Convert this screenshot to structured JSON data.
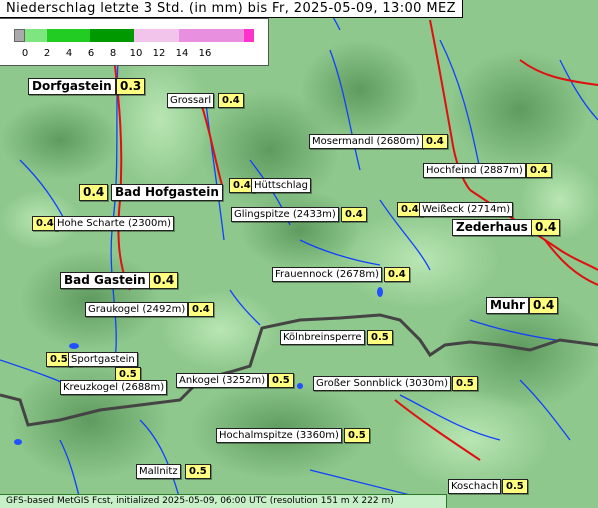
{
  "title": "Niederschlag letzte 3 Std. (in mm) bis Fr, 2025-05-09, 13:00 MEZ",
  "legend": {
    "ticks": [
      "0",
      "2",
      "4",
      "6",
      "8",
      "10",
      "12",
      "14",
      "16"
    ],
    "colors": {
      "zero": "#aaaaaa",
      "light": "#7ee67e",
      "mid": "#22cc22",
      "heavy": "#009900",
      "pinkLight": "#f2c4ec",
      "pinkMid": "#e98fe0",
      "magenta": "#ff33cc"
    }
  },
  "places": [
    {
      "name": "Dorfgastein",
      "value": "0.3"
    },
    {
      "name": "Grossarl",
      "value": "0.4"
    },
    {
      "name": "Mosermandl (2680m)",
      "value": "0.4"
    },
    {
      "name": "Hochfeind (2887m)",
      "value": "0.4"
    },
    {
      "name": "Bad Hofgastein",
      "value": "0.4"
    },
    {
      "name": "Hüttschlag",
      "value": "0.4"
    },
    {
      "name": "Hohe Scharte (2300m)",
      "value": "0.4"
    },
    {
      "name": "Glingspitze (2433m)",
      "value": "0.4"
    },
    {
      "name": "Weißeck (2714m)",
      "value": "0.4"
    },
    {
      "name": "Zederhaus",
      "value": "0.4"
    },
    {
      "name": "Bad Gastein",
      "value": "0.4"
    },
    {
      "name": "Frauennock (2678m)",
      "value": "0.4"
    },
    {
      "name": "Graukogel (2492m)",
      "value": "0.4"
    },
    {
      "name": "Muhr",
      "value": "0.4"
    },
    {
      "name": "Kölnbreinsperre",
      "value": "0.5"
    },
    {
      "name": "Sportgastein",
      "value": "0.5"
    },
    {
      "name": "Kreuzkogel (2688m)",
      "value": "0.5"
    },
    {
      "name": "Ankogel (3252m)",
      "value": "0.5"
    },
    {
      "name": "Großer Sonnblick (3030m)",
      "value": "0.5"
    },
    {
      "name": "Hochalmspitze (3360m)",
      "value": "0.5"
    },
    {
      "name": "Mallnitz",
      "value": "0.5"
    },
    {
      "name": "Koschach",
      "value": "0.5"
    }
  ],
  "footer": "GFS-based MetGIS Fcst, initialized 2025-05-09, 06:00 UTC  (resolution 151 m X 222 m)"
}
